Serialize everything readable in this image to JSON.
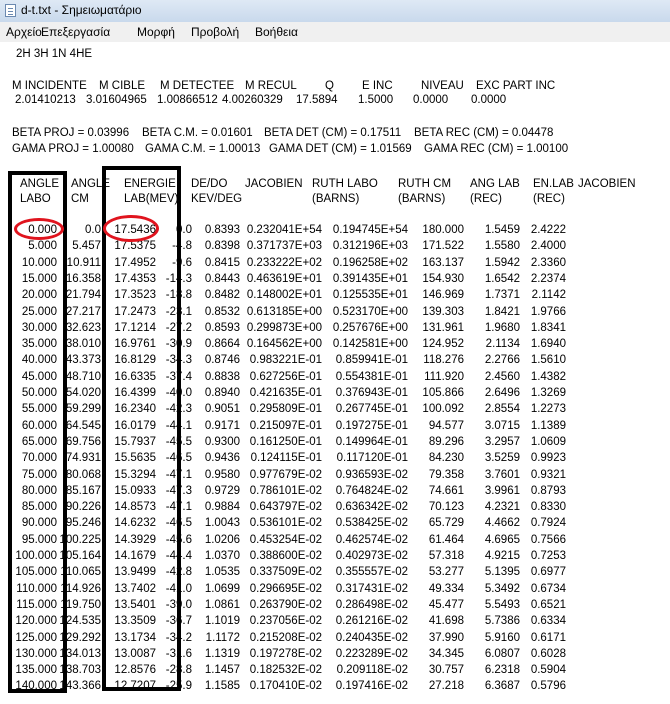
{
  "window": {
    "title": "d-t.txt - Σημειωματάριο"
  },
  "menu": [
    "Αρχείο",
    "Επεξεργασία",
    "Μορφή",
    "Προβολή",
    "Βοήθεια"
  ],
  "text": {
    "line1": "2H  3H  1N  4HE",
    "param_headers": [
      "M INCIDENTE",
      "M CIBLE",
      "M DETECTEE",
      "M RECUL",
      "Q",
      "E INC",
      "NIVEAU",
      "EXC PART INC"
    ],
    "param_values": [
      "2.01410213",
      "3.01604965",
      "1.00866512",
      "4.00260329",
      "17.5894",
      "1.5000",
      "0.0000",
      "0.0000"
    ],
    "beta_line": [
      "BETA PROJ = 0.03996",
      "BETA C.M. = 0.01601",
      "BETA DET (CM) = 0.17511",
      "BETA REC (CM) = 0.04478"
    ],
    "gama_line": [
      "GAMA PROJ = 1.00080",
      "GAMA C.M. = 1.00013",
      "GAMA DET (CM) = 1.01569",
      "GAMA REC (CM) = 1.00100"
    ],
    "col_head1": [
      "ANGLE",
      "ANGLE",
      "ENERGIE",
      "DE/DO",
      "JACOBIEN",
      "RUTH LABO",
      "RUTH CM",
      "ANG LAB",
      "EN.LAB",
      "JACOBIEN"
    ],
    "col_head2": [
      "LABO",
      "CM",
      "LAB(MEV)",
      "KEV/DEG",
      "",
      "(BARNS)",
      "(BARNS)",
      "(REC)",
      "(REC)",
      ""
    ]
  },
  "table": [
    [
      "0.000",
      "0.0",
      "17.5436",
      "0.0",
      "0.8393",
      "0.232041E+54",
      "0.194745E+54",
      "180.000",
      "1.5459",
      "2.4222"
    ],
    [
      "5.000",
      "5.457",
      "17.5375",
      "-4.8",
      "0.8398",
      "0.371737E+03",
      "0.312196E+03",
      "171.522",
      "1.5580",
      "2.4000"
    ],
    [
      "10.000",
      "10.911",
      "17.4952",
      "-9.6",
      "0.8415",
      "0.233222E+02",
      "0.196258E+02",
      "163.137",
      "1.5942",
      "2.3360"
    ],
    [
      "15.000",
      "16.358",
      "17.4353",
      "-14.3",
      "0.8443",
      "0.463619E+01",
      "0.391435E+01",
      "154.930",
      "1.6542",
      "2.2374"
    ],
    [
      "20.000",
      "21.794",
      "17.3523",
      "-18.8",
      "0.8482",
      "0.148002E+01",
      "0.125535E+01",
      "146.969",
      "1.7371",
      "2.1142"
    ],
    [
      "25.000",
      "27.217",
      "17.2473",
      "-23.1",
      "0.8532",
      "0.613185E+00",
      "0.523170E+00",
      "139.303",
      "1.8421",
      "1.9766"
    ],
    [
      "30.000",
      "32.623",
      "17.1214",
      "-27.2",
      "0.8593",
      "0.299873E+00",
      "0.257676E+00",
      "131.961",
      "1.9680",
      "1.8341"
    ],
    [
      "35.000",
      "38.010",
      "16.9761",
      "-30.9",
      "0.8664",
      "0.164562E+00",
      "0.142581E+00",
      "124.952",
      "2.1134",
      "1.6940"
    ],
    [
      "40.000",
      "43.373",
      "16.8129",
      "-34.3",
      "0.8746",
      "0.983221E-01",
      "0.859941E-01",
      "118.276",
      "2.2766",
      "1.5610"
    ],
    [
      "45.000",
      "48.710",
      "16.6335",
      "-37.4",
      "0.8838",
      "0.627256E-01",
      "0.554381E-01",
      "111.920",
      "2.4560",
      "1.4382"
    ],
    [
      "50.000",
      "54.020",
      "16.4399",
      "-40.0",
      "0.8940",
      "0.421635E-01",
      "0.376943E-01",
      "105.866",
      "2.6496",
      "1.3269"
    ],
    [
      "55.000",
      "59.299",
      "16.2340",
      "-42.3",
      "0.9051",
      "0.295809E-01",
      "0.267745E-01",
      "100.092",
      "2.8554",
      "1.2273"
    ],
    [
      "60.000",
      "64.545",
      "16.0179",
      "-44.1",
      "0.9171",
      "0.215097E-01",
      "0.197275E-01",
      "94.577",
      "3.0715",
      "1.1389"
    ],
    [
      "65.000",
      "69.756",
      "15.7937",
      "-45.5",
      "0.9300",
      "0.161250E-01",
      "0.149964E-01",
      "89.296",
      "3.2957",
      "1.0609"
    ],
    [
      "70.000",
      "74.931",
      "15.5635",
      "-46.5",
      "0.9436",
      "0.124115E-01",
      "0.117120E-01",
      "84.230",
      "3.5259",
      "0.9923"
    ],
    [
      "75.000",
      "80.068",
      "15.3294",
      "-47.1",
      "0.9580",
      "0.977679E-02",
      "0.936593E-02",
      "79.358",
      "3.7601",
      "0.9321"
    ],
    [
      "80.000",
      "85.167",
      "15.0933",
      "-47.3",
      "0.9729",
      "0.786101E-02",
      "0.764824E-02",
      "74.661",
      "3.9961",
      "0.8793"
    ],
    [
      "85.000",
      "90.226",
      "14.8573",
      "-47.1",
      "0.9884",
      "0.643797E-02",
      "0.636342E-02",
      "70.123",
      "4.2321",
      "0.8330"
    ],
    [
      "90.000",
      "95.246",
      "14.6232",
      "-46.5",
      "1.0043",
      "0.536101E-02",
      "0.538425E-02",
      "65.729",
      "4.4662",
      "0.7924"
    ],
    [
      "95.000",
      "100.225",
      "14.3929",
      "-45.6",
      "1.0206",
      "0.453254E-02",
      "0.462574E-02",
      "61.464",
      "4.6965",
      "0.7566"
    ],
    [
      "100.000",
      "105.164",
      "14.1679",
      "-44.4",
      "1.0370",
      "0.388600E-02",
      "0.402973E-02",
      "57.318",
      "4.9215",
      "0.7253"
    ],
    [
      "105.000",
      "110.065",
      "13.9499",
      "-42.8",
      "1.0535",
      "0.337509E-02",
      "0.355557E-02",
      "53.277",
      "5.1395",
      "0.6977"
    ],
    [
      "110.000",
      "114.926",
      "13.7402",
      "-41.0",
      "1.0699",
      "0.296695E-02",
      "0.317431E-02",
      "49.334",
      "5.3492",
      "0.6734"
    ],
    [
      "115.000",
      "119.750",
      "13.5401",
      "-39.0",
      "1.0861",
      "0.263790E-02",
      "0.286498E-02",
      "45.477",
      "5.5493",
      "0.6521"
    ],
    [
      "120.000",
      "124.535",
      "13.3509",
      "-36.7",
      "1.1019",
      "0.237056E-02",
      "0.261216E-02",
      "41.698",
      "5.7386",
      "0.6334"
    ],
    [
      "125.000",
      "129.292",
      "13.1734",
      "-34.2",
      "1.1172",
      "0.215208E-02",
      "0.240435E-02",
      "37.990",
      "5.9160",
      "0.6171"
    ],
    [
      "130.000",
      "134.013",
      "13.0087",
      "-31.6",
      "1.1319",
      "0.197278E-02",
      "0.223289E-02",
      "34.345",
      "6.0807",
      "0.6028"
    ],
    [
      "135.000",
      "138.703",
      "12.8576",
      "-28.8",
      "1.1457",
      "0.182532E-02",
      "0.209118E-02",
      "30.757",
      "6.2318",
      "0.5904"
    ],
    [
      "140.000",
      "143.366",
      "12.7207",
      "-25.9",
      "1.1585",
      "0.170410E-02",
      "0.197416E-02",
      "27.218",
      "6.3687",
      "0.5796"
    ]
  ],
  "annotations": {
    "box_color": "#000000",
    "circle_color": "#e0141e"
  }
}
